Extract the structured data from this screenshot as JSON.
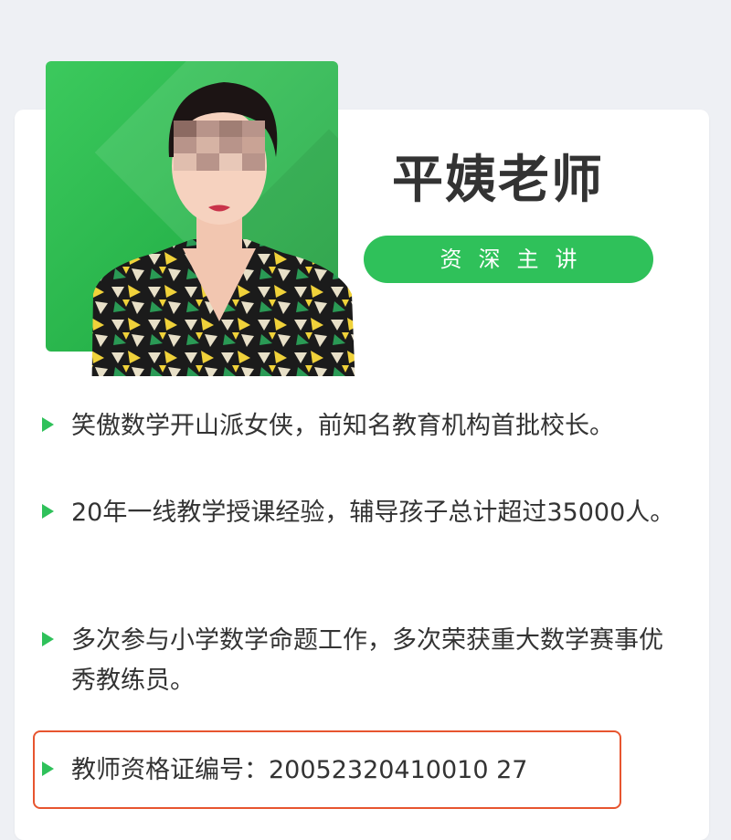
{
  "teacher": {
    "name": "平姨老师",
    "title_badge": "资深主讲"
  },
  "bullets": [
    "笑傲数学开山派女侠，前知名教育机构首批校长。",
    "20年一线教学授课经验，辅导孩子总计超过35000人。",
    "多次参与小学数学命题工作，多次荣获重大数学赛事优秀教练员。",
    "教师资格证编号：20052320410010 27"
  ],
  "colors": {
    "accent_green": "#2fc15a",
    "highlight_border": "#e7552f",
    "text": "#333333",
    "background": "#eef0f4"
  }
}
